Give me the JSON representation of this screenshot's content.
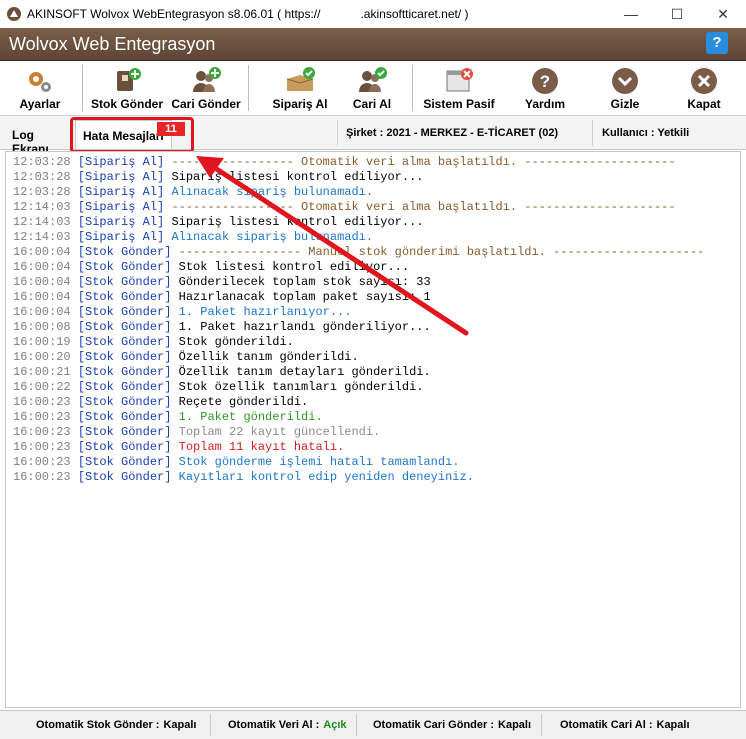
{
  "window": {
    "title": "AKINSOFT Wolvox WebEntegrasyon s8.06.01 ( https://            .akinsoftticaret.net/ )",
    "minimize": "—",
    "maximize": "☐",
    "close": "✕"
  },
  "banner": {
    "name": "Wolvox Web Entegrasyon",
    "help": "?"
  },
  "toolbar": {
    "ayarlar": "Ayarlar",
    "stok_gonder": "Stok Gönder",
    "cari_gonder": "Cari Gönder",
    "siparis_al": "Sipariş Al",
    "cari_al": "Cari Al",
    "sistem_pasif": "Sistem Pasif",
    "yardim": "Yardım",
    "gizle": "Gizle",
    "kapat": "Kapat"
  },
  "tabs": {
    "log": "Log Ekranı",
    "errors": "Hata Mesajları",
    "error_count": "11"
  },
  "info": {
    "company": "Şirket : 2021 - MERKEZ - E-TİCARET (02)",
    "user": "Kullanıcı : Yetkili"
  },
  "log": [
    {
      "time": "12:03:28",
      "src": "[Sipariş Al]",
      "msg": "----------------- Otomatik veri alma başlatıldı. ---------------------",
      "color": "brown"
    },
    {
      "time": "12:03:28",
      "src": "[Sipariş Al]",
      "msg": "Sipariş listesi kontrol ediliyor...",
      "color": "black"
    },
    {
      "time": "12:03:28",
      "src": "[Sipariş Al]",
      "msg": "Alınacak sipariş bulunamadı.",
      "color": "blue"
    },
    {
      "time": "12:14:03",
      "src": "[Sipariş Al]",
      "msg": "----------------- Otomatik veri alma başlatıldı. ---------------------",
      "color": "brown"
    },
    {
      "time": "12:14:03",
      "src": "[Sipariş Al]",
      "msg": "Sipariş listesi kontrol ediliyor...",
      "color": "black"
    },
    {
      "time": "12:14:03",
      "src": "[Sipariş Al]",
      "msg": "Alınacak sipariş bulunamadı.",
      "color": "blue"
    },
    {
      "time": "16:00:04",
      "src": "[Stok Gönder]",
      "msg": "----------------- Manuel stok gönderimi başlatıldı. ---------------------",
      "color": "brown"
    },
    {
      "time": "16:00:04",
      "src": "[Stok Gönder]",
      "msg": "Stok listesi kontrol ediliyor...",
      "color": "black"
    },
    {
      "time": "16:00:04",
      "src": "[Stok Gönder]",
      "msg": "Gönderilecek toplam stok sayısı: 33",
      "color": "black"
    },
    {
      "time": "16:00:04",
      "src": "[Stok Gönder]",
      "msg": "Hazırlanacak toplam paket sayısı: 1",
      "color": "black"
    },
    {
      "time": "16:00:04",
      "src": "[Stok Gönder]",
      "msg": "1. Paket hazırlanıyor...",
      "color": "blue"
    },
    {
      "time": "16:00:08",
      "src": "[Stok Gönder]",
      "msg": "1. Paket hazırlandı gönderiliyor...",
      "color": "black"
    },
    {
      "time": "16:00:19",
      "src": "[Stok Gönder]",
      "msg": "Stok gönderildi.",
      "color": "black"
    },
    {
      "time": "16:00:20",
      "src": "[Stok Gönder]",
      "msg": "Özellik tanım gönderildi.",
      "color": "black"
    },
    {
      "time": "16:00:21",
      "src": "[Stok Gönder]",
      "msg": "Özellik tanım detayları gönderildi.",
      "color": "black"
    },
    {
      "time": "16:00:22",
      "src": "[Stok Gönder]",
      "msg": "Stok özellik tanımları gönderildi.",
      "color": "black"
    },
    {
      "time": "16:00:23",
      "src": "[Stok Gönder]",
      "msg": "Reçete gönderildi.",
      "color": "black"
    },
    {
      "time": "16:00:23",
      "src": "[Stok Gönder]",
      "msg": "1. Paket gönderildi.",
      "color": "green"
    },
    {
      "time": "16:00:23",
      "src": "[Stok Gönder]",
      "msg": "Toplam 22 kayıt güncellendi.",
      "color": "gray"
    },
    {
      "time": "16:00:23",
      "src": "[Stok Gönder]",
      "msg": "Toplam 11 kayıt hatalı.",
      "color": "red"
    },
    {
      "time": "16:00:23",
      "src": "[Stok Gönder]",
      "msg": "Stok gönderme işlemi hatalı tamamlandı.",
      "color": "dblue"
    },
    {
      "time": "16:00:23",
      "src": "[Stok Gönder]",
      "msg": "Kayıtları kontrol edip yeniden deneyiniz.",
      "color": "dblue"
    }
  ],
  "status": {
    "auto_stock_label": "Otomatik Stok Gönder :",
    "auto_stock_value": "Kapalı",
    "auto_data_label": "Otomatik Veri Al :",
    "auto_data_value": "Açık",
    "auto_cari_send_label": "Otomatik Cari Gönder :",
    "auto_cari_send_value": "Kapalı",
    "auto_cari_get_label": "Otomatik Cari Al :",
    "auto_cari_get_value": "Kapalı"
  },
  "colors": {
    "banner": "#6b503e",
    "highlight": "#e1151e",
    "on": "#1f8a1f"
  }
}
